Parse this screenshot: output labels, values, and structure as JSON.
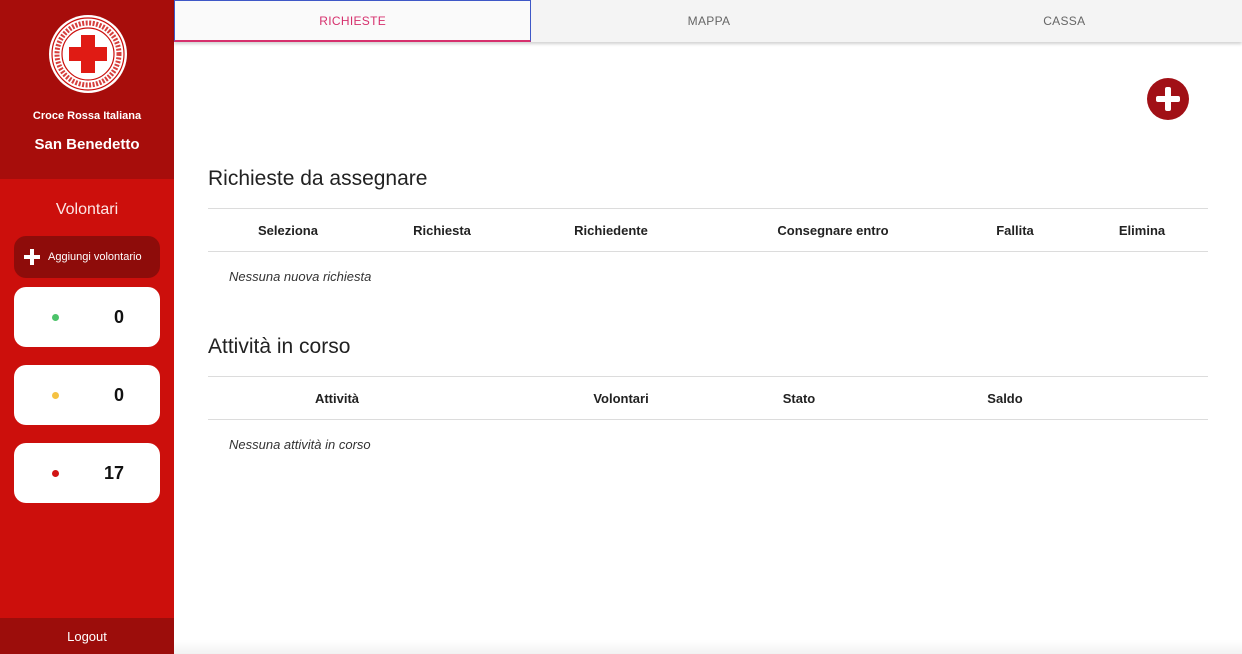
{
  "sidebar": {
    "org_name": "Croce Rossa Italiana",
    "branch_name": "San Benedetto",
    "logo_icon": "red-cross-seal-icon",
    "volunteers_title": "Volontari",
    "add_volunteer_label": "Aggiungi volontario",
    "counters": [
      {
        "status": "available",
        "color": "#4cc36a",
        "count": "0"
      },
      {
        "status": "busy",
        "color": "#f5c242",
        "count": "0"
      },
      {
        "status": "unavailable",
        "color": "#d11414",
        "count": "17"
      }
    ],
    "logout_label": "Logout"
  },
  "tabs": [
    {
      "label": "RICHIESTE",
      "active": true
    },
    {
      "label": "MAPPA",
      "active": false
    },
    {
      "label": "CASSA",
      "active": false
    }
  ],
  "main": {
    "add_request_icon": "plus-circle-icon",
    "requests": {
      "title": "Richieste da assegnare",
      "columns": [
        "Seleziona",
        "Richiesta",
        "Richiedente",
        "Consegnare entro",
        "Fallita",
        "Elimina"
      ],
      "empty_text": "Nessuna nuova richiesta"
    },
    "activities": {
      "title": "Attività in corso",
      "columns": [
        "Attività",
        "Volontari",
        "Stato",
        "Saldo"
      ],
      "empty_text": "Nessuna attività in corso"
    }
  },
  "colors": {
    "sidebar": "#cc0f0c",
    "sidebar_dark": "#a70d0b",
    "accent_tab": "#d6306d",
    "add_button": "#a11016"
  }
}
